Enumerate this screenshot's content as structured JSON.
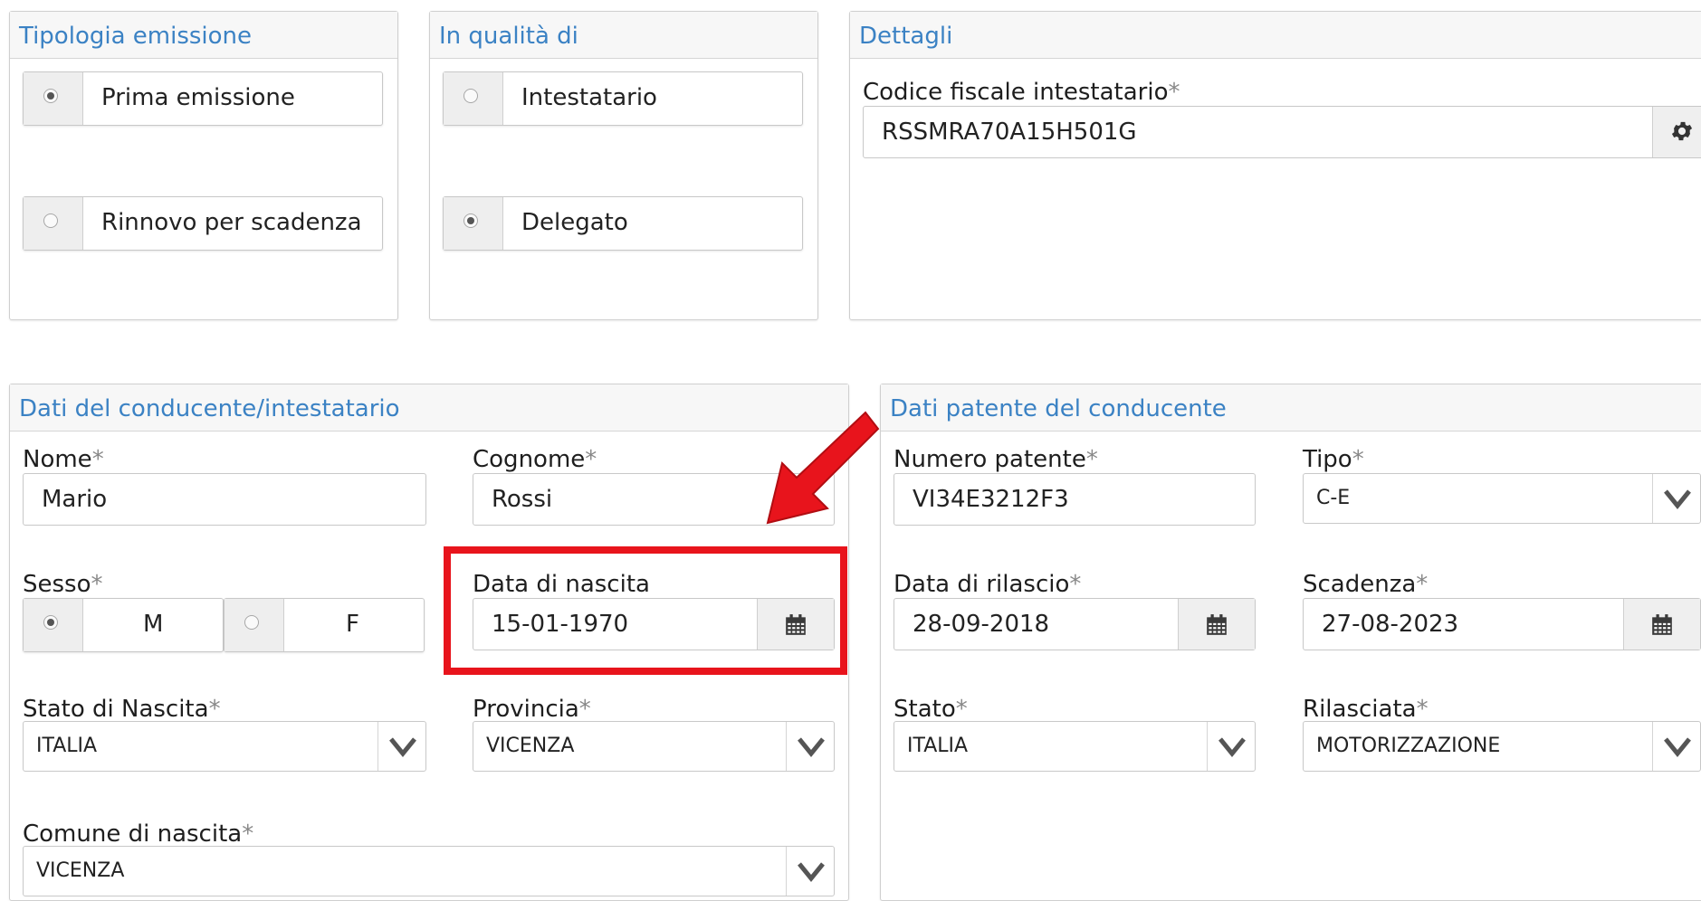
{
  "tipologia": {
    "title": "Tipologia emissione",
    "options": [
      {
        "label": "Prima emissione",
        "selected": true
      },
      {
        "label": "Rinnovo per scadenza",
        "selected": false
      }
    ]
  },
  "qualita": {
    "title": "In qualità di",
    "options": [
      {
        "label": "Intestatario",
        "selected": false
      },
      {
        "label": "Delegato",
        "selected": true
      }
    ]
  },
  "dettagli": {
    "title": "Dettagli",
    "codice_label": "Codice fiscale intestatario",
    "codice_value": "RSSMRA70A15H501G",
    "settings_icon": "gear-icon"
  },
  "conducente": {
    "title": "Dati del conducente/intestatario",
    "nome_label": "Nome",
    "nome_value": "Mario",
    "cognome_label": "Cognome",
    "cognome_value": "Rossi",
    "sesso_label": "Sesso",
    "sesso_options": [
      {
        "label": "M",
        "selected": true
      },
      {
        "label": "F",
        "selected": false
      }
    ],
    "data_nascita_label": "Data di nascita",
    "data_nascita_value": "15-01-1970",
    "stato_nascita_label": "Stato di Nascita",
    "stato_nascita_value": "ITALIA",
    "provincia_label": "Provincia",
    "provincia_value": "VICENZA",
    "comune_label": "Comune di nascita",
    "comune_value": "VICENZA"
  },
  "patente": {
    "title": "Dati patente del conducente",
    "numero_label": "Numero patente",
    "numero_value": "VI34E3212F3",
    "tipo_label": "Tipo",
    "tipo_value": "C-E",
    "rilascio_label": "Data di rilascio",
    "rilascio_value": "28-09-2018",
    "scadenza_label": "Scadenza",
    "scadenza_value": "27-08-2023",
    "stato_label": "Stato",
    "stato_value": "ITALIA",
    "rilasciata_label": "Rilasciata",
    "rilasciata_value": "MOTORIZZAZIONE"
  },
  "required_marker": "*",
  "annotation": {
    "highlight_color": "#e8141c",
    "arrow_color": "#e8141c"
  }
}
